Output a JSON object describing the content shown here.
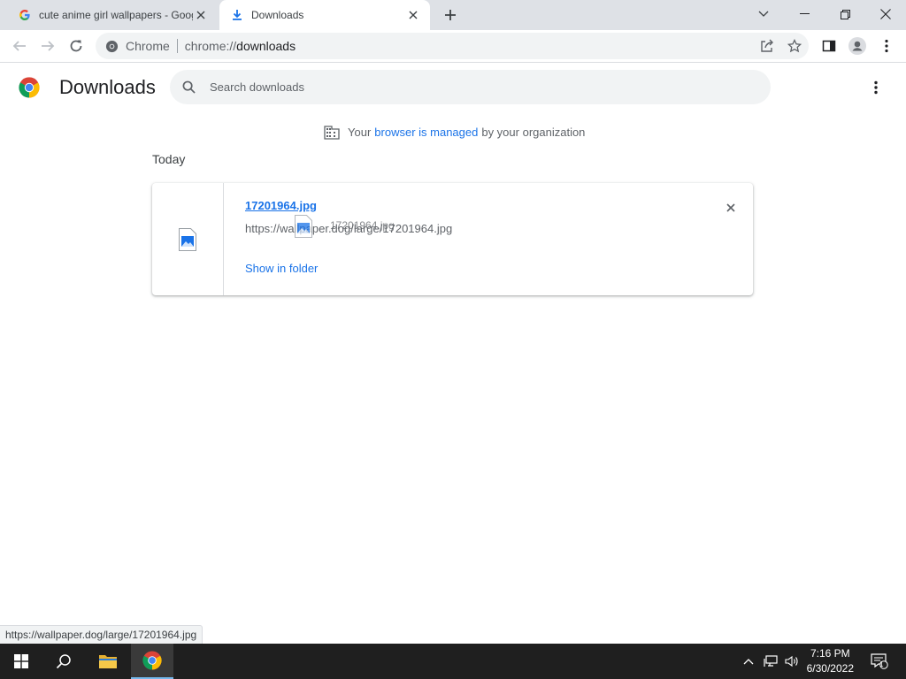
{
  "browser": {
    "tabs": [
      {
        "title": "cute anime girl wallpapers - Google Search",
        "active": false,
        "icon": "google-icon"
      },
      {
        "title": "Downloads",
        "active": true,
        "icon": "download-icon"
      }
    ],
    "omnibox": {
      "chip": "Chrome",
      "url_scheme": "chrome://",
      "url_rest": "downloads"
    }
  },
  "downloads": {
    "title": "Downloads",
    "search_placeholder": "Search downloads",
    "managed": {
      "prefix": "Your",
      "link": "browser is managed",
      "suffix": "by your organization"
    },
    "sections": [
      {
        "date": "Today",
        "items": [
          {
            "file_name": "17201964.jpg",
            "url": "https://wallpaper.dog/large/17201964.jpg",
            "action": "Show in folder"
          }
        ]
      }
    ],
    "drag_ghost_label": "17201964.jpg"
  },
  "status_bubble": "https://wallpaper.dog/large/17201964.jpg",
  "taskbar": {
    "time": "7:16 PM",
    "date": "6/30/2022",
    "notification_count": "1"
  },
  "colors": {
    "accent": "#1a73e8",
    "tabstrip": "#dee1e6",
    "taskbar": "#1f1f1f"
  }
}
